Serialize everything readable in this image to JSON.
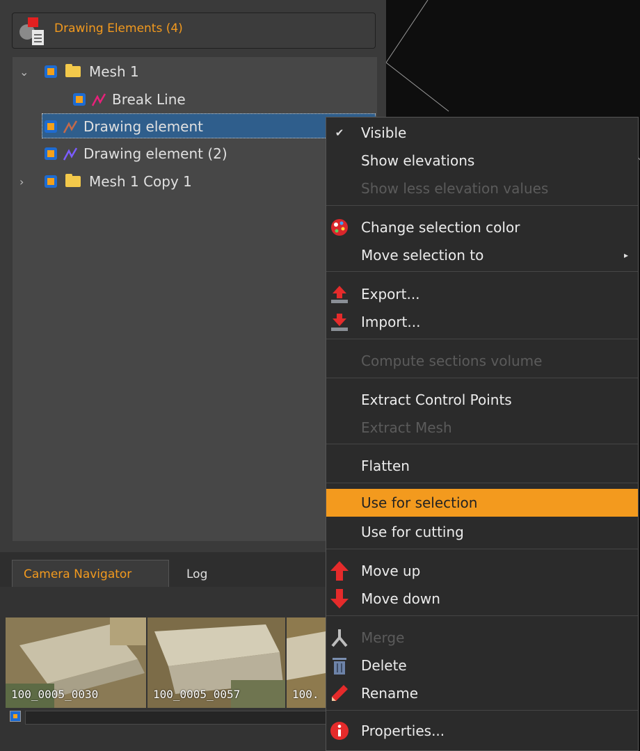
{
  "panel": {
    "title": "Drawing Elements (4)"
  },
  "tree": {
    "items": [
      {
        "label": "Mesh 1",
        "expand": "⌄"
      },
      {
        "label": "Break Line"
      },
      {
        "label": "Drawing element"
      },
      {
        "label": "Drawing element (2)"
      },
      {
        "label": "Mesh 1 Copy 1",
        "expand": "›"
      }
    ]
  },
  "bottom": {
    "tabs": [
      "Camera Navigator",
      "Log"
    ],
    "thumbnails": [
      "100_0005_0030",
      "100_0005_0057",
      "100."
    ]
  },
  "menu": {
    "visible_check": "✔",
    "submenu_arrow": "▸",
    "items": [
      {
        "label": "Visible"
      },
      {
        "label": "Show elevations"
      },
      {
        "label": "Show less elevation values"
      },
      {
        "label": "Change selection color"
      },
      {
        "label": "Move selection to"
      },
      {
        "label": "Export..."
      },
      {
        "label": "Import..."
      },
      {
        "label": "Compute sections volume"
      },
      {
        "label": "Extract Control Points"
      },
      {
        "label": "Extract Mesh"
      },
      {
        "label": "Flatten"
      },
      {
        "label": "Use for selection"
      },
      {
        "label": "Use for cutting"
      },
      {
        "label": "Move up"
      },
      {
        "label": "Move down"
      },
      {
        "label": "Merge"
      },
      {
        "label": "Delete"
      },
      {
        "label": "Rename"
      },
      {
        "label": "Properties..."
      }
    ]
  },
  "colors": {
    "accent": "#f39a1e",
    "selection": "#2f5e8c",
    "checkbox": "#1e6bd1"
  }
}
